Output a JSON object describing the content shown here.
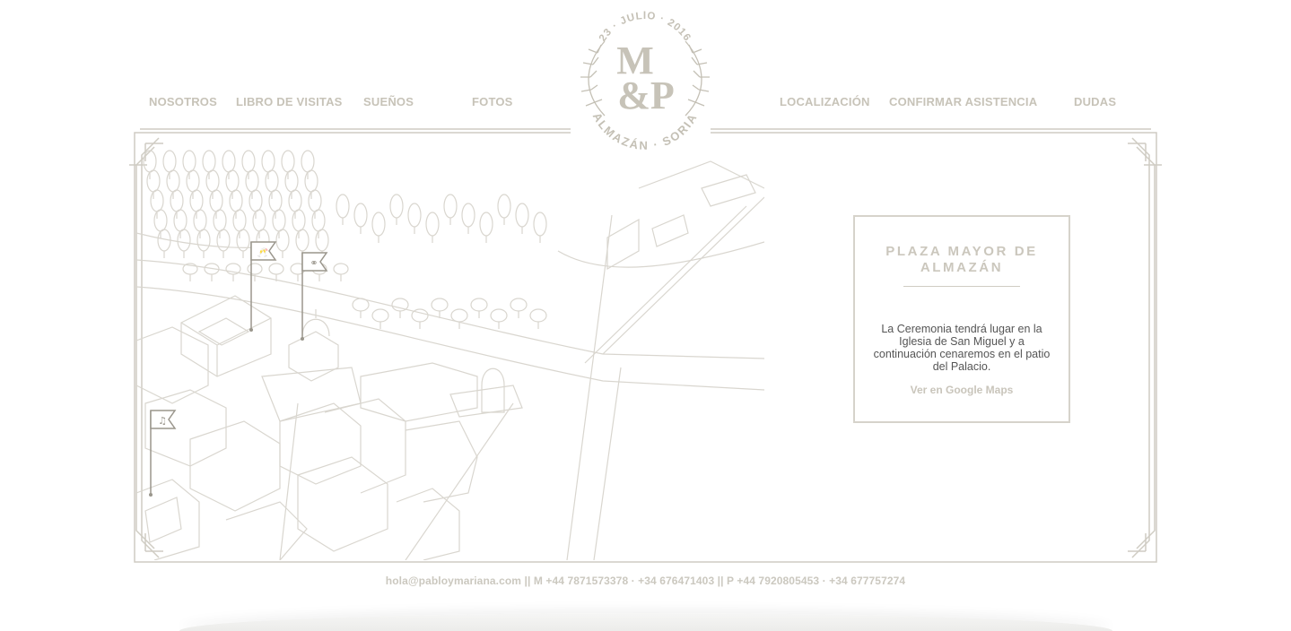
{
  "nav": {
    "left": [
      "NOSOTROS",
      "LIBRO DE VISITAS",
      "SUEÑOS",
      "FOTOS"
    ],
    "right": [
      "LOCALIZACIÓN",
      "CONFIRMAR ASISTENCIA",
      "DUDAS"
    ]
  },
  "logo": {
    "date": "23 · JULIO · 2016",
    "monogram_top": "M",
    "monogram_bottom": "&P",
    "place": "ALMAZÁN · SORIA"
  },
  "map": {
    "flag_icons": [
      "toast-icon",
      "rings-icon",
      "music-icon"
    ]
  },
  "card": {
    "title": "PLAZA MAYOR DE ALMAZÁN",
    "body": "La Ceremonia tendrá lugar en la Iglesia de San Miguel y a continuación cenaremos en el patio del Palacio.",
    "link": "Ver en Google Maps"
  },
  "footer": {
    "contact": "hola@pabloymariana.com || M +44 7871573378 · +34 676471403 || P +44 7920805453 · +34 677757274"
  },
  "colors": {
    "accent": "#c7c3b8",
    "line": "#d6d3cb",
    "body_text": "#555555",
    "background": "#ffffff"
  }
}
